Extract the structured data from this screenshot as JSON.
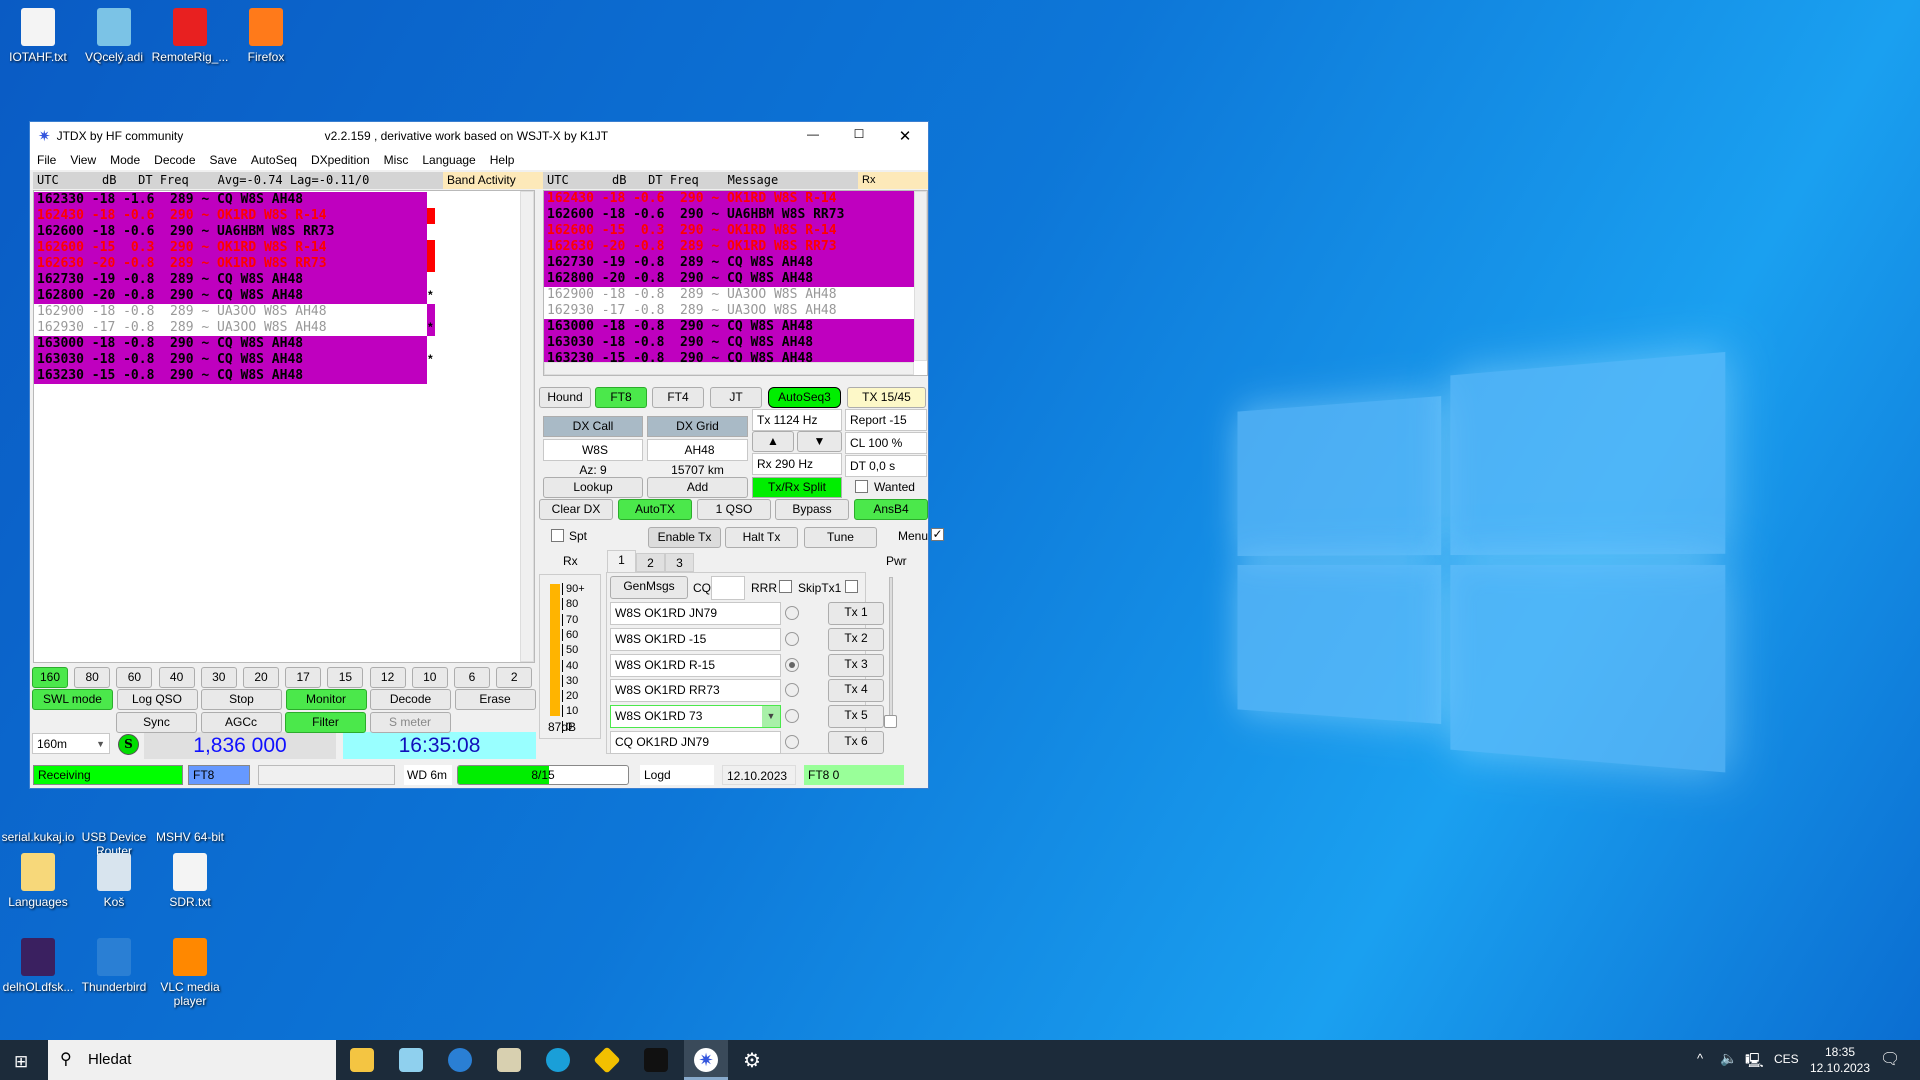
{
  "desktop": {
    "icons": [
      {
        "label": "IOTAHF.txt",
        "color": "#f4f4f4"
      },
      {
        "label": "VQcelý.adi",
        "color": "#7bc3e6"
      },
      {
        "label": "RemoteRig_...",
        "color": "#e82020"
      },
      {
        "label": "Firefox",
        "color": "#ff7a1a"
      },
      {
        "label": "serial.kukaj.io",
        "color": "#3a3a9a"
      },
      {
        "label": "USB Device Router",
        "color": "#d9a040"
      },
      {
        "label": "MSHV 64-bit",
        "color": "#6a3aa0"
      },
      {
        "label": "Languages",
        "color": "#f7d87a"
      },
      {
        "label": "Koš",
        "color": "#d8e4ee"
      },
      {
        "label": "SDR.txt",
        "color": "#f4f4f4"
      },
      {
        "label": "delhOLdfsk...",
        "color": "#3a2060"
      },
      {
        "label": "Thunderbird",
        "color": "#2a7fd4"
      },
      {
        "label": "VLC media player",
        "color": "#ff8800"
      }
    ]
  },
  "window": {
    "app_title": "JTDX  by HF community",
    "version": "v2.2.159 , derivative work based on WSJT-X by K1JT",
    "menu": [
      "File",
      "View",
      "Mode",
      "Decode",
      "Save",
      "AutoSeq",
      "DXpedition",
      "Misc",
      "Language",
      "Help"
    ],
    "band_activity": {
      "header": "UTC      dB   DT Freq    Avg=-0.74 Lag=-0.11/0",
      "label": "Band Activity",
      "rows": [
        {
          "text": "162330 -18 -1.6  289 ~ CQ W8S AH48",
          "style": "mag",
          "mark": ""
        },
        {
          "text": "162430 -18 -0.6  290 ~ OK1RD W8S R-14",
          "style": "mag red",
          "mark": "red"
        },
        {
          "text": "162600 -18 -0.6  290 ~ UA6HBM W8S RR73",
          "style": "mag",
          "mark": ""
        },
        {
          "text": "162600 -15  0.3  290 ~ OK1RD W8S R-14",
          "style": "mag red",
          "mark": "red"
        },
        {
          "text": "162630 -20 -0.8  289 ~ OK1RD W8S RR73",
          "style": "mag red",
          "mark": "red"
        },
        {
          "text": "162730 -19 -0.8  289 ~ CQ W8S AH48",
          "style": "mag",
          "mark": ""
        },
        {
          "text": "162800 -20 -0.8  290 ~ CQ W8S AH48",
          "style": "mag",
          "mark": "*"
        },
        {
          "text": "162900 -18 -0.8  289 ~ UA3OO W8S AH48",
          "style": "grey",
          "mark": "mag"
        },
        {
          "text": "162930 -17 -0.8  289 ~ UA3OO W8S AH48",
          "style": "grey",
          "mark": "mag*"
        },
        {
          "text": "163000 -18 -0.8  290 ~ CQ W8S AH48",
          "style": "mag",
          "mark": ""
        },
        {
          "text": "163030 -18 -0.8  290 ~ CQ W8S AH48",
          "style": "mag",
          "mark": "*"
        },
        {
          "text": "163230 -15 -0.8  290 ~ CQ W8S AH48",
          "style": "mag",
          "mark": ""
        }
      ]
    },
    "rx_frequency": {
      "header": "UTC      dB   DT Freq    Message",
      "label": "Rx Frequency",
      "rows": [
        {
          "text": "162430 -18 -0.6  290 ~ OK1RD W8S R-14",
          "style": "mag red"
        },
        {
          "text": "162600 -18 -0.6  290 ~ UA6HBM W8S RR73",
          "style": "mag"
        },
        {
          "text": "162600 -15  0.3  290 ~ OK1RD W8S R-14",
          "style": "mag red"
        },
        {
          "text": "162630 -20 -0.8  289 ~ OK1RD W8S RR73",
          "style": "mag red"
        },
        {
          "text": "162730 -19 -0.8  289 ~ CQ W8S AH48",
          "style": "mag"
        },
        {
          "text": "162800 -20 -0.8  290 ~ CQ W8S AH48",
          "style": "mag"
        },
        {
          "text": "162900 -18 -0.8  289 ~ UA3OO W8S AH48",
          "style": "grey"
        },
        {
          "text": "162930 -17 -0.8  289 ~ UA3OO W8S AH48",
          "style": "grey"
        },
        {
          "text": "163000 -18 -0.8  290 ~ CQ W8S AH48",
          "style": "mag"
        },
        {
          "text": "163030 -18 -0.8  290 ~ CQ W8S AH48",
          "style": "mag"
        },
        {
          "text": "163230 -15 -0.8  290 ~ CQ W8S AH48",
          "style": "mag"
        }
      ]
    },
    "mode_buttons": [
      {
        "label": "Hound",
        "on": false
      },
      {
        "label": "FT8",
        "on": true
      },
      {
        "label": "FT4",
        "on": false
      },
      {
        "label": "JT",
        "on": false
      },
      {
        "label": "AutoSeq3",
        "on": true
      },
      {
        "label": "TX 15/45",
        "on": false
      }
    ],
    "dx": {
      "call_label": "DX Call",
      "grid_label": "DX Grid",
      "call": "W8S",
      "grid": "AH48",
      "az": "Az: 9",
      "dist": "15707 km",
      "lookup": "Lookup",
      "add": "Add"
    },
    "tx_freq": "Tx  1124  Hz",
    "rx_freq": "Rx  290  Hz",
    "report": "Report -15",
    "cl": "CL  100 %",
    "dt": "DT 0,0 s",
    "up": "▲",
    "down": "▼",
    "split": "Tx/Rx Split",
    "wanted": "Wanted",
    "row2": [
      "Clear DX",
      "AutoTX",
      "1 QSO",
      "Bypass",
      "AnsB4"
    ],
    "spt": "Spt",
    "enable_tx": "Enable Tx",
    "halt_tx": "Halt Tx",
    "tune": "Tune",
    "menu_label": "Menu",
    "rx_label": "Rx",
    "pwr_label": "Pwr",
    "meter": {
      "ticks": [
        "90+",
        "80",
        "70",
        "60",
        "50",
        "40",
        "30",
        "20",
        "10",
        "0"
      ],
      "level_db": "87dB",
      "fill_percent": 97
    },
    "tabs": [
      "1",
      "2",
      "3"
    ],
    "genmsgs": "GenMsgs",
    "cq": "CQ",
    "rrr": "RRR",
    "skiptx1": "SkipTx1",
    "messages": [
      {
        "text": "W8S OK1RD JN79",
        "btn": "Tx 1"
      },
      {
        "text": "W8S OK1RD -15",
        "btn": "Tx 2"
      },
      {
        "text": "W8S OK1RD R-15",
        "btn": "Tx 3"
      },
      {
        "text": "W8S OK1RD RR73",
        "btn": "Tx 4"
      },
      {
        "text": "W8S OK1RD 73",
        "btn": "Tx 5"
      },
      {
        "text": "CQ OK1RD JN79",
        "btn": "Tx 6"
      }
    ],
    "selected_tx": 3,
    "bands": [
      "160",
      "80",
      "60",
      "40",
      "30",
      "20",
      "17",
      "15",
      "12",
      "10",
      "6",
      "2"
    ],
    "ctrl1": [
      {
        "label": "SWL mode",
        "on": true
      },
      {
        "label": "Log QSO",
        "on": false
      },
      {
        "label": "Stop",
        "on": false
      },
      {
        "label": "Monitor",
        "on": true
      },
      {
        "label": "Decode",
        "on": false
      },
      {
        "label": "Erase",
        "on": false
      }
    ],
    "ctrl2": [
      {
        "label": "Sync",
        "on": false
      },
      {
        "label": "AGCc",
        "on": false
      },
      {
        "label": "Filter",
        "on": true
      },
      {
        "label": "S meter",
        "on": false
      }
    ],
    "band_select": "160m",
    "s_label": "S",
    "frequency": "1,836 000",
    "clock": "16:35:08",
    "status": {
      "state": "Receiving",
      "mode": "FT8",
      "wd": "WD 6m",
      "progress": "8/15",
      "progress_fraction": 0.533,
      "log": "Logd",
      "date": "12.10.2023",
      "ft8count": "FT8  0"
    }
  },
  "taskbar": {
    "search": "Hledat",
    "time": "18:35",
    "date": "12.10.2023",
    "lang": "CES"
  }
}
